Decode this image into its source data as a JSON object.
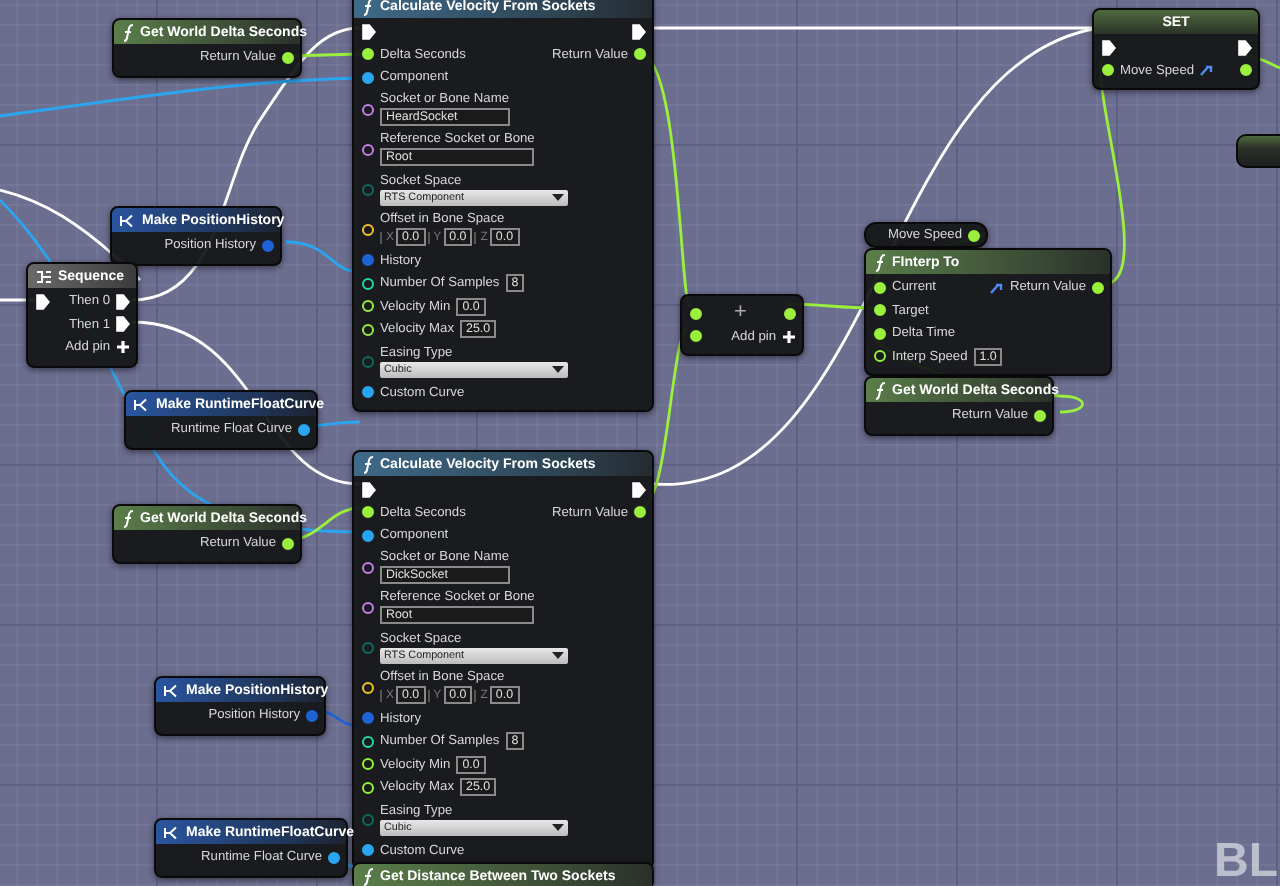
{
  "graph": {
    "nodes": [
      {
        "kind": "pure_function",
        "title": "Get World Delta Seconds",
        "outputs": [
          {
            "kind": "float",
            "label": "Return Value",
            "connected": true
          }
        ]
      },
      {
        "kind": "function",
        "title": "Calculate Velocity From Sockets",
        "inputs": [
          {
            "kind": "exec",
            "connected": true
          },
          {
            "kind": "float",
            "label": "Delta Seconds",
            "connected": true
          },
          {
            "kind": "object",
            "label": "Component",
            "connected": true
          },
          {
            "kind": "name",
            "label": "Socket or Bone Name",
            "connected": false,
            "value": "HeardSocket"
          },
          {
            "kind": "name",
            "label": "Reference Socket or Bone",
            "connected": false,
            "value": "Root"
          },
          {
            "kind": "enum",
            "label": "Socket Space",
            "connected": false,
            "value": "RTS Component"
          },
          {
            "kind": "vector",
            "label": "Offset in Bone Space",
            "connected": false,
            "value": [
              {
                "axis": "X",
                "text": "0.0"
              },
              {
                "axis": "Y",
                "text": "0.0"
              },
              {
                "axis": "Z",
                "text": "0.0"
              }
            ]
          },
          {
            "kind": "struct",
            "label": "History",
            "connected": true
          },
          {
            "kind": "int",
            "label": "Number Of Samples",
            "connected": false,
            "value": "8"
          },
          {
            "kind": "float",
            "label": "Velocity Min",
            "connected": false,
            "value": "0.0"
          },
          {
            "kind": "float",
            "label": "Velocity Max",
            "connected": false,
            "value": "25.0"
          },
          {
            "kind": "enum",
            "label": "Easing Type",
            "connected": false,
            "value": "Cubic"
          },
          {
            "kind": "object",
            "label": "Custom Curve",
            "connected": true
          }
        ],
        "outputs": [
          {
            "kind": "exec",
            "connected": true
          },
          {
            "kind": "float",
            "label": "Return Value",
            "connected": true
          }
        ]
      },
      {
        "kind": "make",
        "title": "Make PositionHistory",
        "outputs": [
          {
            "kind": "struct",
            "label": "Position History",
            "connected": true
          }
        ]
      },
      {
        "kind": "macro",
        "title": "Sequence",
        "inputs": [
          {
            "kind": "exec",
            "connected": true
          }
        ],
        "outputs": [
          {
            "kind": "exec",
            "label": "Then 0",
            "connected": true
          },
          {
            "kind": "exec",
            "label": "Then 1",
            "connected": true
          },
          {
            "kind": "adder",
            "label": "Add pin"
          }
        ]
      },
      {
        "kind": "make",
        "title": "Make RuntimeFloatCurve",
        "outputs": [
          {
            "kind": "object",
            "label": "Runtime Float Curve",
            "connected": true
          }
        ]
      },
      {
        "kind": "pure_function",
        "title": "Get World Delta Seconds",
        "outputs": [
          {
            "kind": "float",
            "label": "Return Value",
            "connected": true
          }
        ]
      },
      {
        "kind": "function",
        "title": "Calculate Velocity From Sockets",
        "inputs": [
          {
            "kind": "exec",
            "connected": true
          },
          {
            "kind": "float",
            "label": "Delta Seconds",
            "connected": true
          },
          {
            "kind": "object",
            "label": "Component",
            "connected": true
          },
          {
            "kind": "name",
            "label": "Socket or Bone Name",
            "connected": false,
            "value": "DickSocket"
          },
          {
            "kind": "name",
            "label": "Reference Socket or Bone",
            "connected": false,
            "value": "Root"
          },
          {
            "kind": "enum",
            "label": "Socket Space",
            "connected": false,
            "value": "RTS Component"
          },
          {
            "kind": "vector",
            "label": "Offset in Bone Space",
            "connected": false,
            "value": [
              {
                "axis": "X",
                "text": "0.0"
              },
              {
                "axis": "Y",
                "text": "0.0"
              },
              {
                "axis": "Z",
                "text": "0.0"
              }
            ]
          },
          {
            "kind": "struct",
            "label": "History",
            "connected": true
          },
          {
            "kind": "int",
            "label": "Number Of Samples",
            "connected": false,
            "value": "8"
          },
          {
            "kind": "float",
            "label": "Velocity Min",
            "connected": false,
            "value": "0.0"
          },
          {
            "kind": "float",
            "label": "Velocity Max",
            "connected": false,
            "value": "25.0"
          },
          {
            "kind": "enum",
            "label": "Easing Type",
            "connected": false,
            "value": "Cubic"
          },
          {
            "kind": "object",
            "label": "Custom Curve",
            "connected": true
          }
        ],
        "outputs": [
          {
            "kind": "exec",
            "connected": true
          },
          {
            "kind": "float",
            "label": "Return Value",
            "connected": true
          }
        ]
      },
      {
        "kind": "make",
        "title": "Make PositionHistory",
        "outputs": [
          {
            "kind": "struct",
            "label": "Position History",
            "connected": true
          }
        ]
      },
      {
        "kind": "make",
        "title": "Make RuntimeFloatCurve",
        "outputs": [
          {
            "kind": "object",
            "label": "Runtime Float Curve",
            "connected": true
          }
        ]
      },
      {
        "kind": "add",
        "symbol": "+",
        "inputs": [
          {
            "kind": "float",
            "connected": true
          },
          {
            "kind": "float",
            "connected": true
          }
        ],
        "outputs": [
          {
            "kind": "float",
            "connected": true
          },
          {
            "kind": "adder",
            "label": "Add pin"
          }
        ]
      },
      {
        "kind": "variable",
        "outputs": [
          {
            "kind": "float",
            "label": "Move Speed",
            "connected": true
          }
        ]
      },
      {
        "kind": "pure_function",
        "title": "FInterp To",
        "inputs": [
          {
            "kind": "float",
            "label": "Current",
            "connected": true
          },
          {
            "kind": "float",
            "label": "Target",
            "connected": true
          },
          {
            "kind": "float",
            "label": "Delta Time",
            "connected": true
          },
          {
            "kind": "float",
            "label": "Interp Speed",
            "connected": false,
            "value": "1.0"
          }
        ],
        "outputs": [
          {
            "kind": "float",
            "label": "Return Value",
            "connected": true,
            "badge": true
          }
        ]
      },
      {
        "kind": "pure_function",
        "title": "Get World Delta Seconds",
        "outputs": [
          {
            "kind": "float",
            "label": "Return Value",
            "connected": true
          }
        ]
      },
      {
        "kind": "set",
        "title": "SET",
        "inputs": [
          {
            "kind": "exec",
            "connected": true
          },
          {
            "kind": "float",
            "label": "Move Speed",
            "connected": true,
            "badge": true
          }
        ],
        "outputs": [
          {
            "kind": "exec",
            "connected": true
          },
          {
            "kind": "float",
            "connected": true
          }
        ]
      },
      {
        "kind": "pure_function",
        "title": "Get Distance Between Two Sockets"
      }
    ],
    "corner_label": "BL"
  }
}
